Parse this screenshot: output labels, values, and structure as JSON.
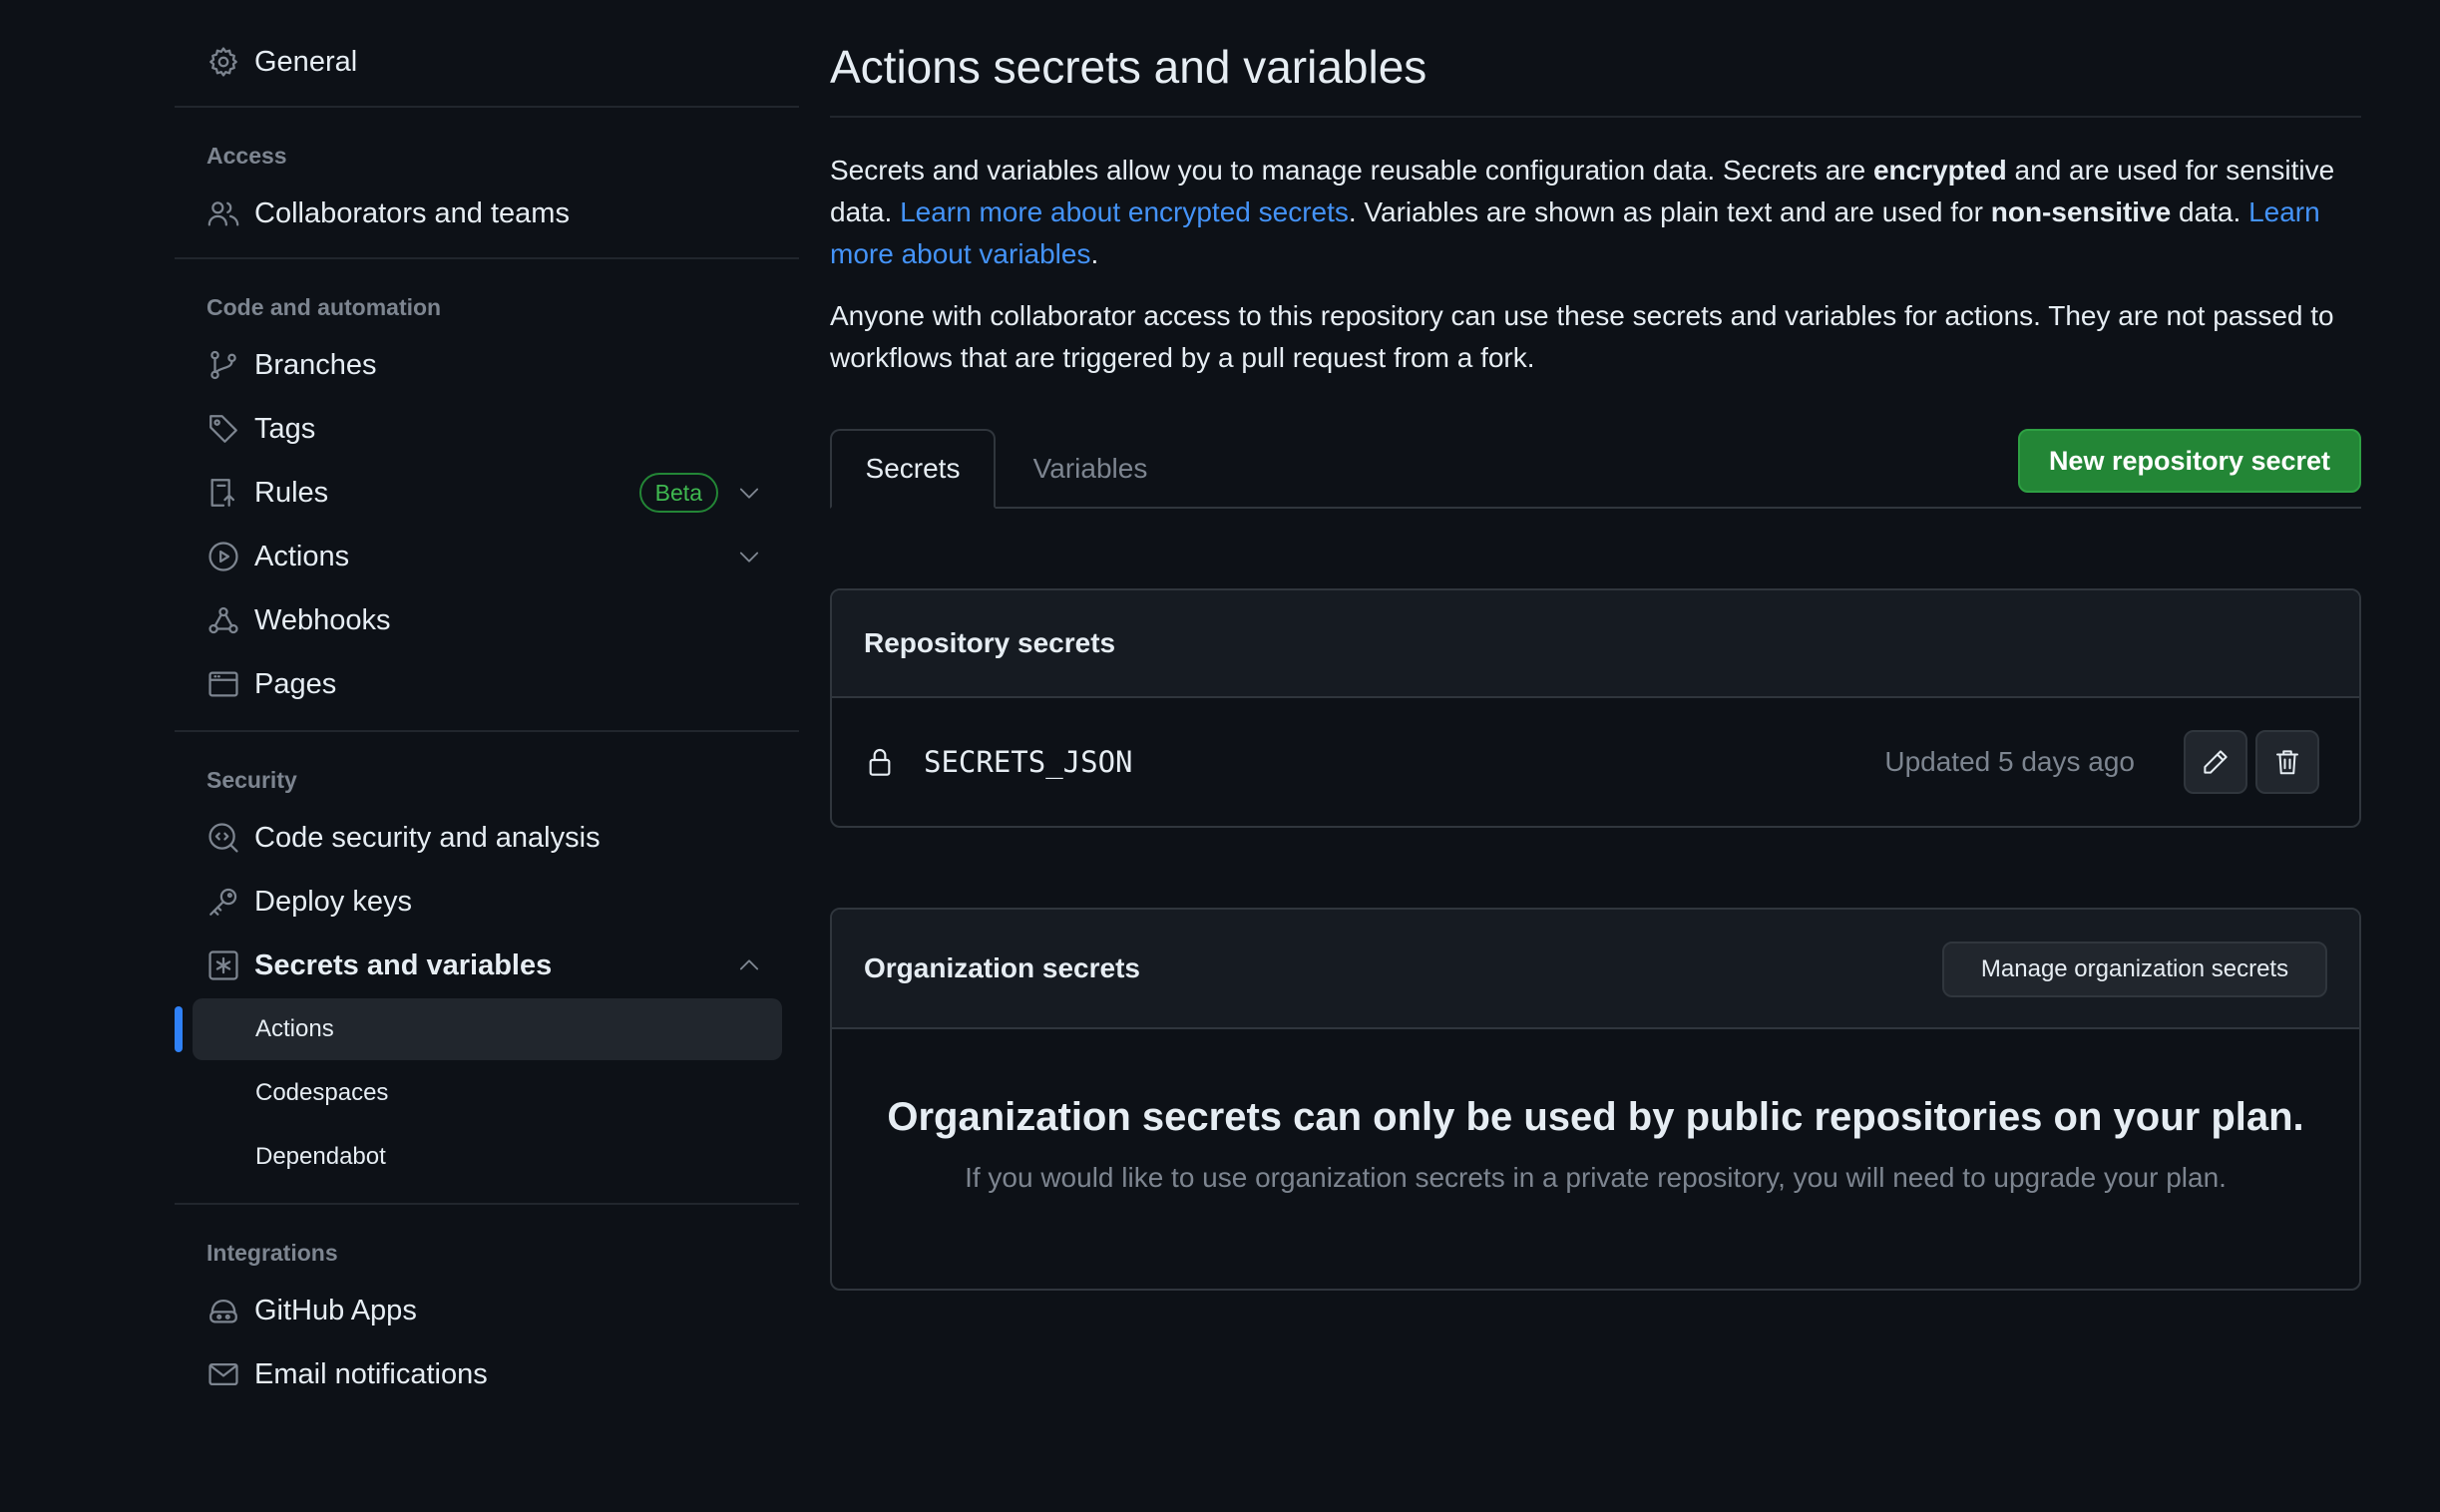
{
  "sidebar": {
    "general": "General",
    "access": {
      "heading": "Access",
      "items": [
        {
          "label": "Collaborators and teams",
          "icon": "people-icon"
        }
      ]
    },
    "code": {
      "heading": "Code and automation",
      "items": [
        {
          "label": "Branches",
          "icon": "branch-icon"
        },
        {
          "label": "Tags",
          "icon": "tag-icon"
        },
        {
          "label": "Rules",
          "icon": "rules-icon",
          "badge": "Beta"
        },
        {
          "label": "Actions",
          "icon": "play-icon"
        },
        {
          "label": "Webhooks",
          "icon": "webhook-icon"
        },
        {
          "label": "Pages",
          "icon": "browser-icon"
        }
      ]
    },
    "security": {
      "heading": "Security",
      "items": [
        {
          "label": "Code security and analysis",
          "icon": "codescan-icon"
        },
        {
          "label": "Deploy keys",
          "icon": "key-icon"
        },
        {
          "label": "Secrets and variables",
          "icon": "asterisk-icon"
        }
      ],
      "sub_items": [
        "Actions",
        "Codespaces",
        "Dependabot"
      ]
    },
    "integrations": {
      "heading": "Integrations",
      "items": [
        {
          "label": "GitHub Apps",
          "icon": "copilot-icon"
        },
        {
          "label": "Email notifications",
          "icon": "mail-icon"
        }
      ]
    }
  },
  "main": {
    "title": "Actions secrets and variables",
    "desc": {
      "p1": "Secrets and variables allow you to manage reusable configuration data. Secrets are ",
      "b1": "encrypted",
      "p2": " and are used for sensitive data. ",
      "link1": "Learn more about encrypted secrets",
      "p3": ". Variables are shown as plain text and are used for ",
      "b2": "non-sensitive",
      "p4": " data. ",
      "link2": "Learn more about variables",
      "p5": "."
    },
    "desc2": "Anyone with collaborator access to this repository can use these secrets and variables for actions. They are not passed to workflows that are triggered by a pull request from a fork.",
    "tabs": [
      "Secrets",
      "Variables"
    ],
    "new_secret_button": "New repository secret",
    "repo_secrets": {
      "heading": "Repository secrets",
      "rows": [
        {
          "name": "SECRETS_JSON",
          "updated": "Updated 5 days ago"
        }
      ]
    },
    "org_secrets": {
      "heading": "Organization secrets",
      "manage_button": "Manage organization secrets",
      "empty_title": "Organization secrets can only be used by public repositories on your plan.",
      "empty_sub": "If you would like to use organization secrets in a private repository, you will need to upgrade your plan."
    }
  },
  "colors": {
    "background": "#0d1117",
    "accent_blue": "#2f81f7",
    "link": "#4493f8",
    "primary_green": "#238636",
    "beta_green": "#3fb950"
  }
}
